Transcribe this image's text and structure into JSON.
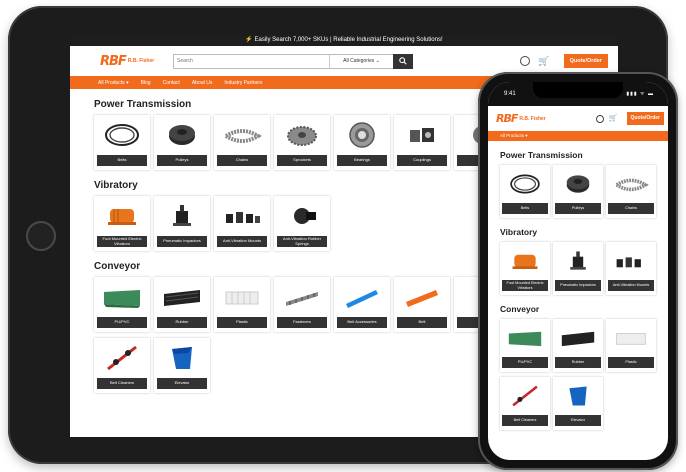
{
  "topbar": {
    "text": "⚡ Easily Search 7,000+ SKUs | Reliable Industrial Engineering Solutions!"
  },
  "brand": {
    "mark": "RBF",
    "name": "R.B. Fisher",
    "color": "#f26a1b"
  },
  "search": {
    "placeholder": "Search",
    "category": "All Categories ⌄"
  },
  "header": {
    "quote_label": "Quote/Order",
    "cart_icon": "cart-icon",
    "user_icon": "user-icon"
  },
  "nav": {
    "items": [
      "All Products ▾",
      "Blog",
      "Contact",
      "About Us",
      "Industry Partners"
    ]
  },
  "sections": [
    {
      "title": "Power Transmission",
      "items": [
        "Belts",
        "Pulleys",
        "Chains",
        "Sprockets",
        "Bearings",
        "Couplings",
        "Ge"
      ]
    },
    {
      "title": "Vibratory",
      "items": [
        "Foot Mounted Electric Vibrators",
        "Pneumatic Impactors",
        "Anti-Vibration Mounts",
        "Anti-Vibration Rubber Springs"
      ]
    },
    {
      "title": "Conveyor",
      "items": [
        "PU/PVC",
        "Rubber",
        "Plastic",
        "Fasteners",
        "Belt Accessories",
        "Belt",
        "",
        "Belt Cleaners",
        "Elevator"
      ]
    }
  ],
  "phone": {
    "time": "9:41",
    "signal": "▮▮▮ ᯤ ▬",
    "nav": "All Products ▾",
    "quote_label": "Quote/Order",
    "sections": [
      {
        "title": "Power Transmission",
        "items": [
          "Belts",
          "Pulleys",
          "Chains"
        ]
      },
      {
        "title": "Vibratory",
        "items": [
          "Foot Mounted Electric Vibrators",
          "Pneumatic Impactors",
          "Anti-Vibration Mounts"
        ]
      },
      {
        "title": "Conveyor",
        "items": [
          "PU/PVC",
          "Rubber",
          "Plastic",
          "Belt Cleaners",
          "Elevator"
        ]
      }
    ]
  },
  "colors": {
    "accent": "#f26a1b",
    "dark": "#333333",
    "topbar": "#1e1e1e"
  }
}
